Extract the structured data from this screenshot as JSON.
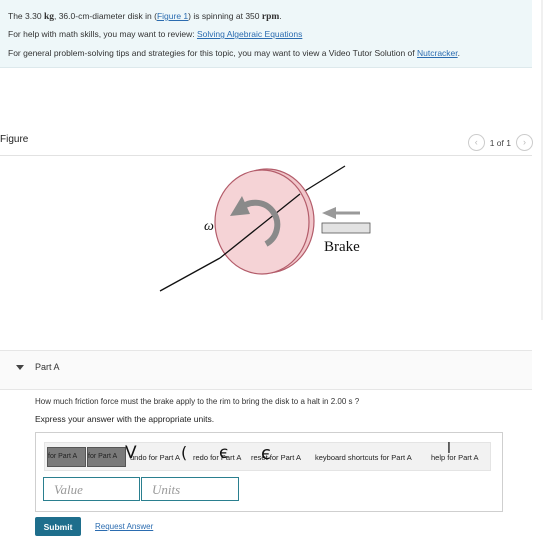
{
  "intro": {
    "line1": {
      "prefix": "The 3.30",
      "unit_kg": "kg",
      "mid": ", 36.0-cm-diameter disk in (",
      "figure_link": "Figure 1",
      "after_link": ") is spinning at 350",
      "unit_rpm": "rpm",
      "end": "."
    },
    "line2": {
      "text": "For help with math skills, you may want to review:",
      "link": "Solving Algebraic Equations"
    },
    "line3": {
      "text": "For general problem-solving tips and strategies for this topic, you may want to view a Video Tutor Solution of",
      "link": "Nutcracker",
      "end": "."
    }
  },
  "figure": {
    "title": "Figure",
    "pager": "1 of 1",
    "omega_label": "ω",
    "brake_label": "Brake",
    "colors": {
      "disk_fill": "#f5d3d6",
      "disk_stroke": "#b35c6a"
    }
  },
  "partA": {
    "title": "Part A",
    "question": "How much friction force must the brake apply to the rim to bring the disk to a halt in 2.00 s ?",
    "express": "Express your answer with the appropriate units.",
    "toolbar": {
      "btn1": "for Part A",
      "btn2": "for Part A",
      "undo": "undo for Part A",
      "redo": "redo for Part A",
      "reset": "reset for Part A",
      "shortcuts": "keyboard shortcuts for Part A",
      "help": "help for Part A"
    },
    "value_placeholder": "Value",
    "units_placeholder": "Units",
    "submit": "Submit",
    "request": "Request Answer"
  }
}
